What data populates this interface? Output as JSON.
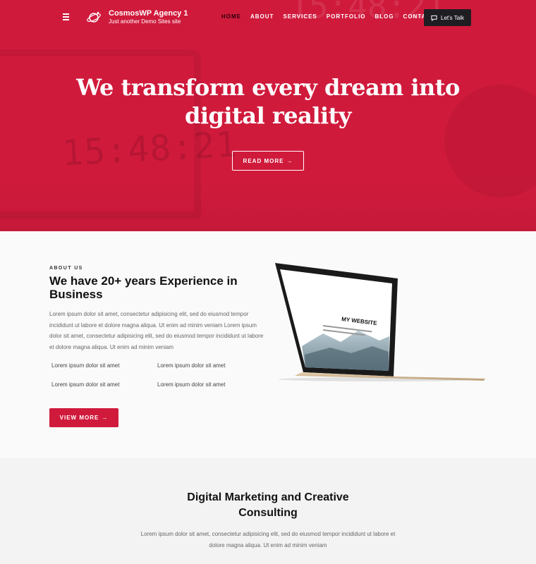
{
  "header": {
    "site_title": "CosmosWP Agency 1",
    "site_tagline": "Just another Demo Sites site",
    "nav": [
      {
        "label": "HOME",
        "active": true
      },
      {
        "label": "ABOUT"
      },
      {
        "label": "SERVICES"
      },
      {
        "label": "PORTFOLIO"
      },
      {
        "label": "BLOG"
      },
      {
        "label": "CONTACT"
      }
    ],
    "cta_label": "Let's Talk",
    "cta_icon": "chat-bubble-icon",
    "menu_icon": "hamburger-icon",
    "logo_icon": "planet-icon"
  },
  "hero": {
    "title_line1": "We transform every dream into",
    "title_line2": "digital reality",
    "button_label": "READ MORE",
    "arrow": "→",
    "bg_clock_text": "15:48:21",
    "bg_top_clock_text": "15:48:21",
    "bg_color": "#d01a3c"
  },
  "about": {
    "eyebrow": "ABOUT US",
    "heading": "We have 20+ years Experience in Business",
    "paragraph": "Lorem ipsum dolor sit amet, consectetur adipisicing elit, sed do eiusmod tempor incididunt ut labore et dolore magna aliqua. Ut enim ad minim veniam Lorem ipsum dolor sit amet, consectetur adipisicing elit, sed do eiusmod tempor incididunt ut labore et dolore magna aliqua. Ut enim ad minim veniam",
    "bullets": [
      "Lorem ipsum dolor sit amet",
      "Lorem ipsum dolor sit amet",
      "Lorem ipsum dolor sit amet",
      "Lorem ipsum dolor sit amet"
    ],
    "button_label": "VIEW MORE",
    "arrow": "→",
    "screen_title": "MY WEBSITE"
  },
  "marketing": {
    "heading": "Digital Marketing and Creative Consulting",
    "paragraph": "Lorem ipsum dolor sit amet, consectetur adipisicing elit, sed do eiusmod tempor incididunt ut labore et dolore magna aliqua. Ut enim ad minim veniam"
  },
  "colors": {
    "accent": "#d01a3c",
    "dark_button": "#1e1e22"
  }
}
